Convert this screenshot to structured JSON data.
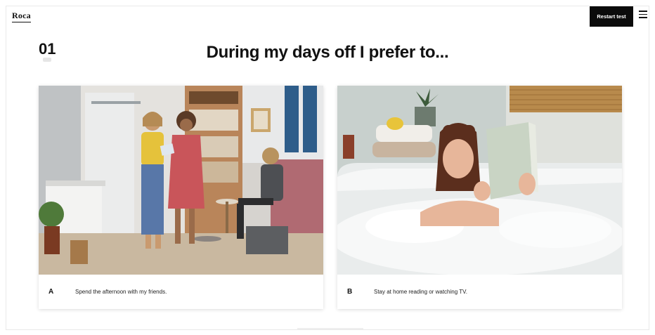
{
  "brand": {
    "logo_text": "Roca"
  },
  "header": {
    "restart_label": "Restart test"
  },
  "question": {
    "number": "01",
    "title": "During my days off I prefer to..."
  },
  "options": [
    {
      "letter": "A",
      "text": "Spend the afternoon with my friends."
    },
    {
      "letter": "B",
      "text": "Stay at home reading or watching TV."
    }
  ],
  "colors": {
    "button_bg": "#0b0b0b",
    "accent_wall": "#b06a72",
    "wood": "#b9855a"
  },
  "icons": [
    "menu-icon"
  ]
}
